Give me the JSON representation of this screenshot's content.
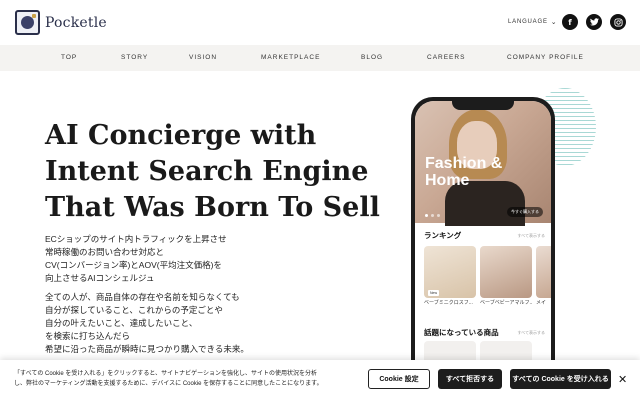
{
  "header": {
    "logo_text": "Pocketle",
    "language_label": "LANGUAGE",
    "social": [
      {
        "name": "facebook",
        "glyph": "f"
      },
      {
        "name": "twitter",
        "glyph": "t"
      },
      {
        "name": "instagram",
        "glyph": "◎"
      }
    ]
  },
  "nav": {
    "items": [
      "TOP",
      "STORY",
      "VISION",
      "MARKETPLACE",
      "BLOG",
      "CAREERS",
      "COMPANY PROFILE"
    ]
  },
  "hero": {
    "title_lines": [
      "AI Concierge with",
      "Intent Search Engine",
      "That Was Born To Sell"
    ],
    "paragraph1": [
      "ECショップのサイト内トラフィックを上昇させ",
      "常時稼働のお問い合わせ対応と",
      "CV(コンバージョン率)とAOV(平均注文価格)を",
      "向上させるAIコンシェルジュ"
    ],
    "paragraph2": [
      "全ての人が、商品自体の存在や名前を知らなくても",
      "自分が探していること、これからの予定ごとや",
      "自分の叶えたいこと、達成したいこと、",
      "を検索に打ち込んだら",
      "希望に沿った商品が瞬時に見つかり購入できる未来。"
    ]
  },
  "phone": {
    "hero_text": [
      "Fashion &",
      "Home"
    ],
    "hero_button": "今すぐ購入する",
    "ranking_title": "ランキング",
    "ranking_more": "すべて表示する",
    "ranking_items": [
      "ベーブミニクロスフ...",
      "ベーブベビーアマルフ...",
      "メイ"
    ],
    "new_badge": "New",
    "topics_title": "話題になっている商品",
    "topics_more": "すべて表示する"
  },
  "cookie": {
    "text_lines": [
      "「すべての Cookie を受け入れる」をクリックすると、サイトナビゲーションを強化し、サイトの使用状況を分析",
      "し、弊社のマーケティング活動を支援するために、デバイスに Cookie を保存することに同意したことになります。"
    ],
    "settings_label": "Cookie 設定",
    "reject_label": "すべて拒否する",
    "accept_label": "すべての Cookie を受け入れる",
    "close_glyph": "✕"
  }
}
